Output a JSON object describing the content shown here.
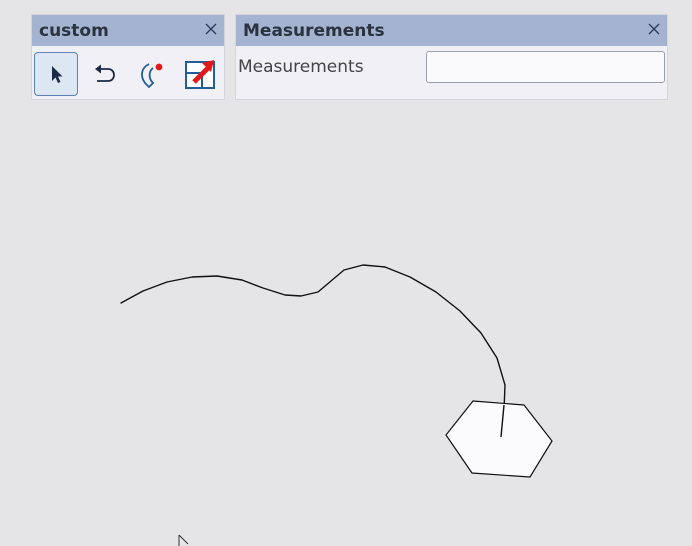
{
  "custom_panel": {
    "title": "custom",
    "tools": [
      {
        "name": "select-tool",
        "icon": "pointer-arrow-icon",
        "active": true
      },
      {
        "name": "undo-tool",
        "icon": "undo-arrow-icon",
        "active": false
      },
      {
        "name": "path-edit-tool",
        "icon": "curve-node-icon",
        "active": false
      },
      {
        "name": "expand-tool",
        "icon": "expand-arrow-icon",
        "active": false
      }
    ]
  },
  "measurements_panel": {
    "title": "Measurements",
    "label": "Measurements",
    "value": ""
  },
  "colors": {
    "header": "#a4b4d0",
    "panel_bg": "#f1f0f6",
    "canvas_bg": "#e5e4e6",
    "accent_red": "#e01a1a",
    "icon_blue": "#1f5f9a"
  }
}
